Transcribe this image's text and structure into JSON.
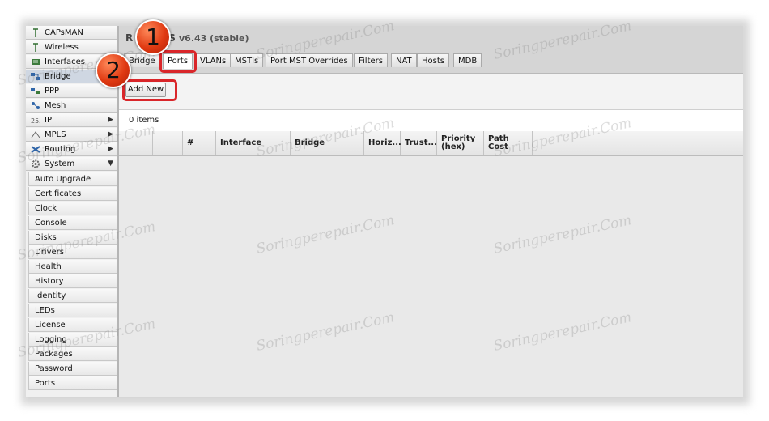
{
  "app": {
    "title_partial": "R",
    "title_suffix": "S",
    "version": "v6.43 (stable)"
  },
  "sidebar": {
    "items": [
      {
        "label": "CAPsMAN",
        "icon": "antenna-icon"
      },
      {
        "label": "Wireless",
        "icon": "antenna-icon"
      },
      {
        "label": "Interfaces",
        "icon": "interfaces-icon"
      },
      {
        "label": "Bridge",
        "icon": "bridge-icon",
        "active": true
      },
      {
        "label": "PPP",
        "icon": "ppp-icon"
      },
      {
        "label": "Mesh",
        "icon": "mesh-icon"
      },
      {
        "label": "IP",
        "icon": "ip-icon",
        "arrow": "▶"
      },
      {
        "label": "MPLS",
        "icon": "mpls-icon",
        "arrow": "▶"
      },
      {
        "label": "Routing",
        "icon": "routing-icon",
        "arrow": "▶"
      },
      {
        "label": "System",
        "icon": "gear-icon",
        "arrow": "▼"
      }
    ],
    "subitems": [
      "Auto Upgrade",
      "Certificates",
      "Clock",
      "Console",
      "Disks",
      "Drivers",
      "Health",
      "History",
      "Identity",
      "LEDs",
      "License",
      "Logging",
      "Packages",
      "Password",
      "Ports"
    ]
  },
  "tabs": [
    "Bridge",
    "Ports",
    "VLANs",
    "MSTIs",
    "Port MST Overrides",
    "Filters",
    "NAT",
    "Hosts",
    "MDB"
  ],
  "toolbar": {
    "add_label": "Add New"
  },
  "list": {
    "count": "0 items"
  },
  "table": {
    "headers": [
      "",
      "",
      "#",
      "Interface",
      "Bridge",
      "Horiz...",
      "Trust...",
      "Priority (hex)",
      "Path Cost",
      ""
    ]
  },
  "callouts": [
    "1",
    "2"
  ],
  "watermark": "Soringperepair.Com",
  "colors": {
    "highlight": "#d9262a",
    "badge": "#e03a12",
    "active_menu": "#cfd7e2"
  }
}
